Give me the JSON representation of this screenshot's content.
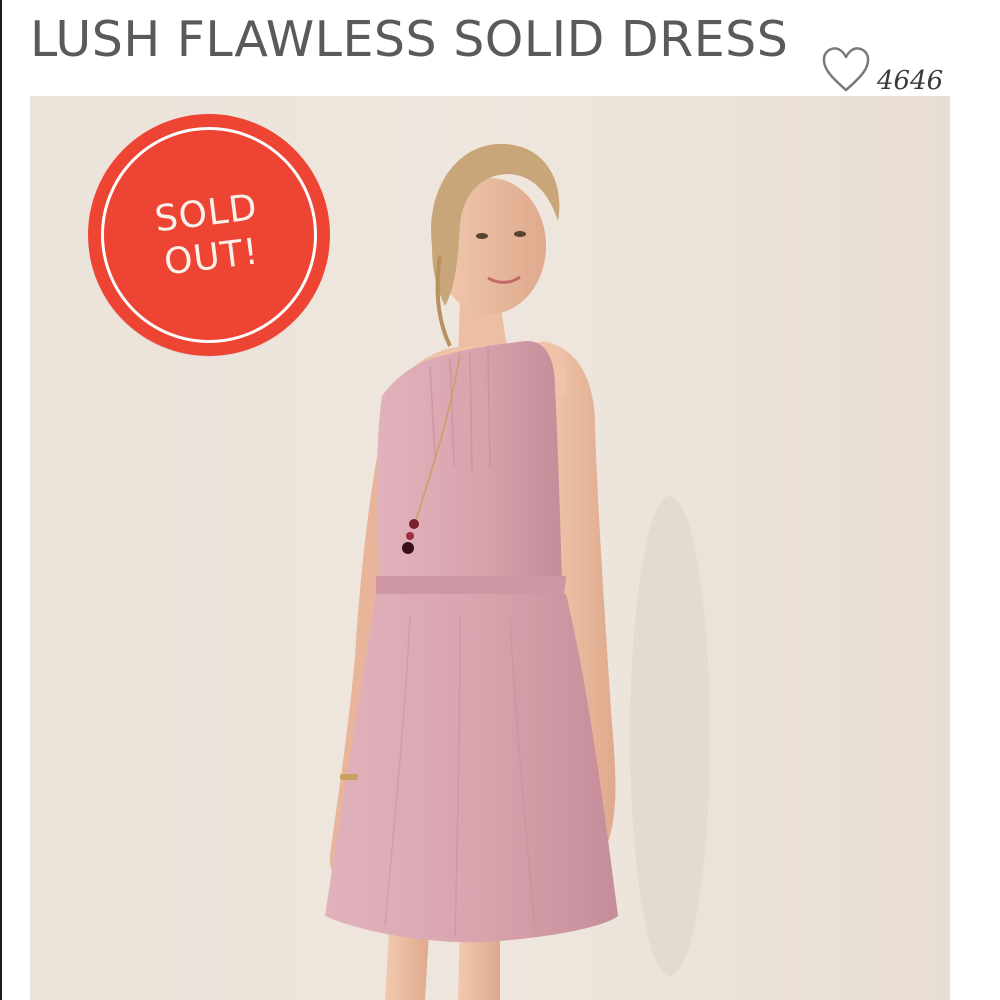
{
  "product": {
    "title": "LUSH FLAWLESS SOLID DRESS",
    "like_count": "4646",
    "like_icon": "heart-outline-icon"
  },
  "badge": {
    "line1": "SOLD",
    "line2": "OUT!",
    "color": "#ee4433"
  },
  "colors": {
    "title": "#5a5a5a",
    "background": "#ece4db",
    "dress": "#d9a3ae"
  }
}
